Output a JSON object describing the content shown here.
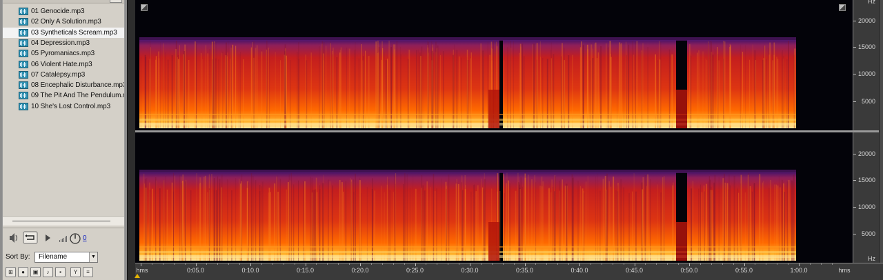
{
  "files": [
    {
      "label": "01 Genocide.mp3",
      "selected": false
    },
    {
      "label": "02 Only A Solution.mp3",
      "selected": false
    },
    {
      "label": "03 Syntheticals Scream.mp3",
      "selected": true
    },
    {
      "label": "04 Depression.mp3",
      "selected": false
    },
    {
      "label": "05 Pyromaniacs.mp3",
      "selected": false
    },
    {
      "label": "06 Violent Hate.mp3",
      "selected": false
    },
    {
      "label": "07 Catalepsy.mp3",
      "selected": false
    },
    {
      "label": "08 Encephalic Disturbance.mp3",
      "selected": false
    },
    {
      "label": "09 The Pit And The Pendulum.mp3",
      "selected": false
    },
    {
      "label": "10 She's Lost Control.mp3",
      "selected": false
    }
  ],
  "transport": {
    "volume_value": "0"
  },
  "sort": {
    "label": "Sort By:",
    "value": "Filename"
  },
  "frequency_ruler": {
    "unit": "Hz",
    "labels": [
      "20000",
      "15000",
      "10000",
      "5000"
    ]
  },
  "time_ruler": {
    "unit_left": "hms",
    "unit_right": "hms",
    "labels": [
      "0:05.0",
      "0:10.0",
      "0:15.0",
      "0:20.0",
      "0:25.0",
      "0:30.0",
      "0:35.0",
      "0:40.0",
      "0:45.0",
      "0:50.0",
      "0:55.0",
      "1:00.0"
    ]
  },
  "colors": {
    "spectrum_high": "#ffe9a0",
    "spectrum_mid": "#ff6a00",
    "spectrum_low": "#c41e1e",
    "spectrum_top": "#6a1e6a",
    "background": "#030309"
  }
}
